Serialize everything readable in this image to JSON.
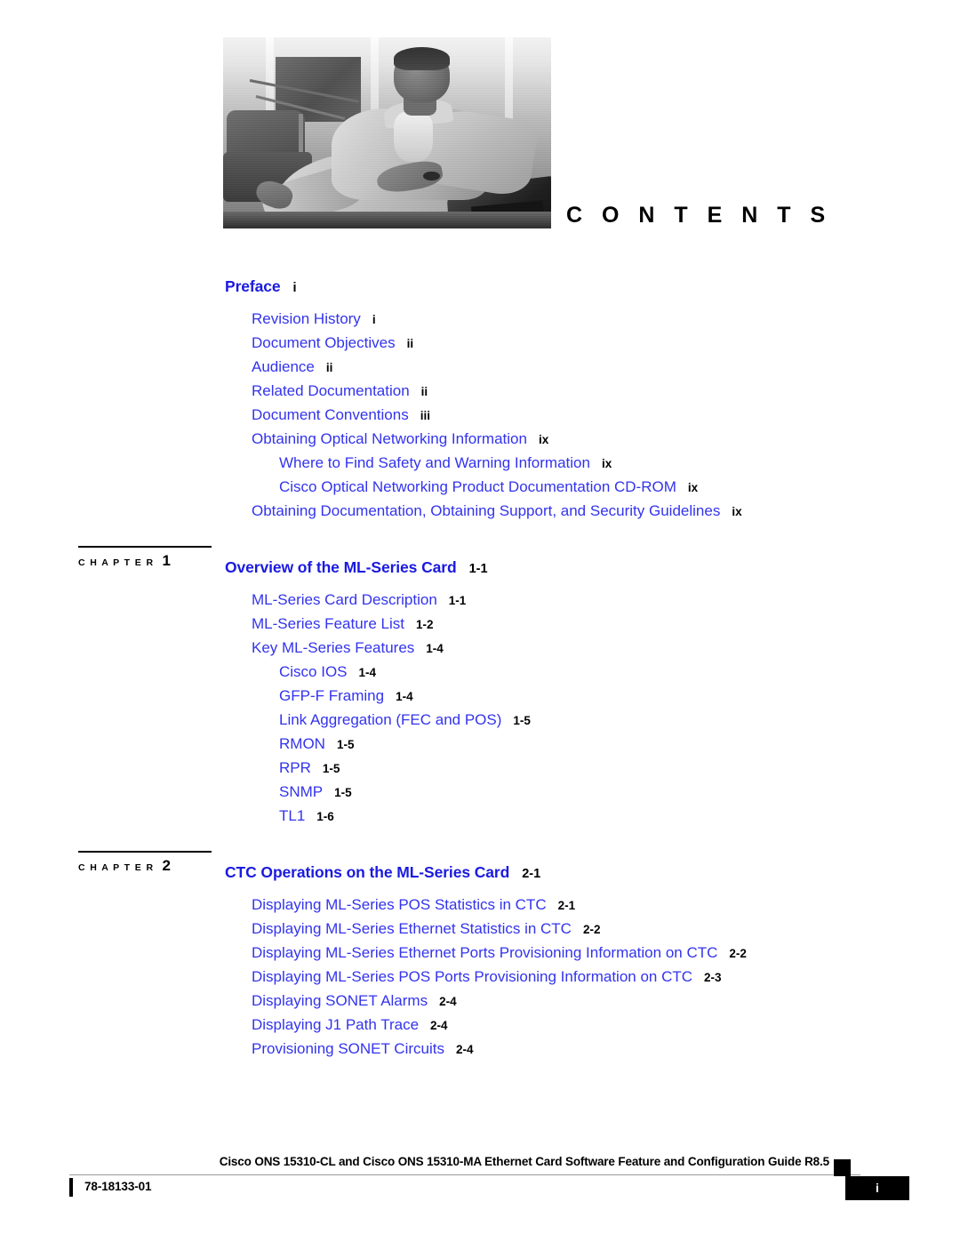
{
  "page": {
    "contents_title": "C O N T E N T S"
  },
  "header": {
    "photo_alt": "man seated on sofa in loft office, grayscale"
  },
  "toc": [
    {
      "kind": "part",
      "marker": null,
      "title": "Preface",
      "page": "i",
      "entries": [
        {
          "level": 1,
          "label": "Revision History",
          "page": "i"
        },
        {
          "level": 1,
          "label": "Document Objectives",
          "page": "ii"
        },
        {
          "level": 1,
          "label": "Audience",
          "page": "ii"
        },
        {
          "level": 1,
          "label": "Related Documentation",
          "page": "ii"
        },
        {
          "level": 1,
          "label": "Document Conventions",
          "page": "iii"
        },
        {
          "level": 1,
          "label": "Obtaining Optical Networking Information",
          "page": "ix"
        },
        {
          "level": 2,
          "label": "Where to Find Safety and Warning Information",
          "page": "ix"
        },
        {
          "level": 2,
          "label": "Cisco Optical Networking Product Documentation CD-ROM",
          "page": "ix"
        },
        {
          "level": 1,
          "label": "Obtaining Documentation, Obtaining Support, and Security Guidelines",
          "page": "ix"
        }
      ]
    },
    {
      "kind": "chapter",
      "marker": {
        "word": "C H A P T E R",
        "number": "1"
      },
      "title": "Overview of the ML-Series Card",
      "page": "1-1",
      "entries": [
        {
          "level": 1,
          "label": "ML-Series Card Description",
          "page": "1-1"
        },
        {
          "level": 1,
          "label": "ML-Series Feature List",
          "page": "1-2"
        },
        {
          "level": 1,
          "label": "Key ML-Series Features",
          "page": "1-4"
        },
        {
          "level": 2,
          "label": "Cisco IOS",
          "page": "1-4"
        },
        {
          "level": 2,
          "label": "GFP-F Framing",
          "page": "1-4"
        },
        {
          "level": 2,
          "label": "Link Aggregation (FEC and POS)",
          "page": "1-5"
        },
        {
          "level": 2,
          "label": "RMON",
          "page": "1-5"
        },
        {
          "level": 2,
          "label": "RPR",
          "page": "1-5"
        },
        {
          "level": 2,
          "label": "SNMP",
          "page": "1-5"
        },
        {
          "level": 2,
          "label": "TL1",
          "page": "1-6"
        }
      ]
    },
    {
      "kind": "chapter",
      "marker": {
        "word": "C H A P T E R",
        "number": "2"
      },
      "title": "CTC Operations on the ML-Series Card",
      "page": "2-1",
      "entries": [
        {
          "level": 1,
          "label": "Displaying ML-Series POS Statistics in CTC",
          "page": "2-1"
        },
        {
          "level": 1,
          "label": "Displaying ML-Series Ethernet Statistics in CTC",
          "page": "2-2"
        },
        {
          "level": 1,
          "label": "Displaying ML-Series Ethernet Ports Provisioning Information on CTC",
          "page": "2-2"
        },
        {
          "level": 1,
          "label": "Displaying ML-Series POS Ports Provisioning Information on CTC",
          "page": "2-3"
        },
        {
          "level": 1,
          "label": "Displaying SONET Alarms",
          "page": "2-4"
        },
        {
          "level": 1,
          "label": "Displaying J1 Path Trace",
          "page": "2-4"
        },
        {
          "level": 1,
          "label": "Provisioning SONET Circuits",
          "page": "2-4"
        }
      ]
    }
  ],
  "footer": {
    "title": "Cisco ONS 15310-CL and Cisco ONS 15310-MA Ethernet Card Software Feature and Configuration Guide R8.5",
    "doc_number": "78-18133-01",
    "page_number": "i"
  },
  "colors": {
    "part_heading": "#1a1ae0",
    "entry_link": "#3333ee",
    "page_number": "#000000"
  }
}
